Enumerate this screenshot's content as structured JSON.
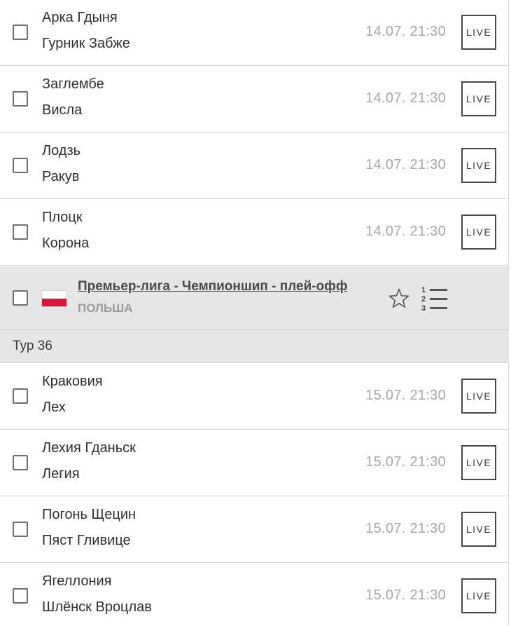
{
  "group1": {
    "matches": [
      {
        "home": "Арка Гдыня",
        "away": "Гурник Забже",
        "time": "14.07. 21:30",
        "live": "LIVE"
      },
      {
        "home": "Заглембе",
        "away": "Висла",
        "time": "14.07. 21:30",
        "live": "LIVE"
      },
      {
        "home": "Лодзь",
        "away": "Ракув",
        "time": "14.07. 21:30",
        "live": "LIVE"
      },
      {
        "home": "Плоцк",
        "away": "Корона",
        "time": "14.07. 21:30",
        "live": "LIVE"
      }
    ]
  },
  "league": {
    "name": "Премьер-лига - Чемпионшип - плей-офф",
    "country": "ПОЛЬША",
    "flag": {
      "top_color": "#ffffff",
      "bottom_color": "#dc143c"
    },
    "favorite_icon": "star-outline-icon",
    "standings_icon": "standings-list-icon",
    "standings_numbers": [
      "1",
      "2",
      "3"
    ]
  },
  "round": {
    "label": "Тур 36"
  },
  "group2": {
    "matches": [
      {
        "home": "Краковия",
        "away": "Лех",
        "time": "15.07. 21:30",
        "live": "LIVE"
      },
      {
        "home": "Лехия Гданьск",
        "away": "Легия",
        "time": "15.07. 21:30",
        "live": "LIVE"
      },
      {
        "home": "Погонь Щецин",
        "away": "Пяст Гливице",
        "time": "15.07. 21:30",
        "live": "LIVE"
      },
      {
        "home": "Ягеллония",
        "away": "Шлёнск Вроцлав",
        "time": "15.07. 21:30",
        "live": "LIVE"
      }
    ]
  },
  "colors": {
    "header_bg": "#e6e6e6",
    "time_text": "#a6a6a6",
    "border": "#d4d4d4"
  }
}
